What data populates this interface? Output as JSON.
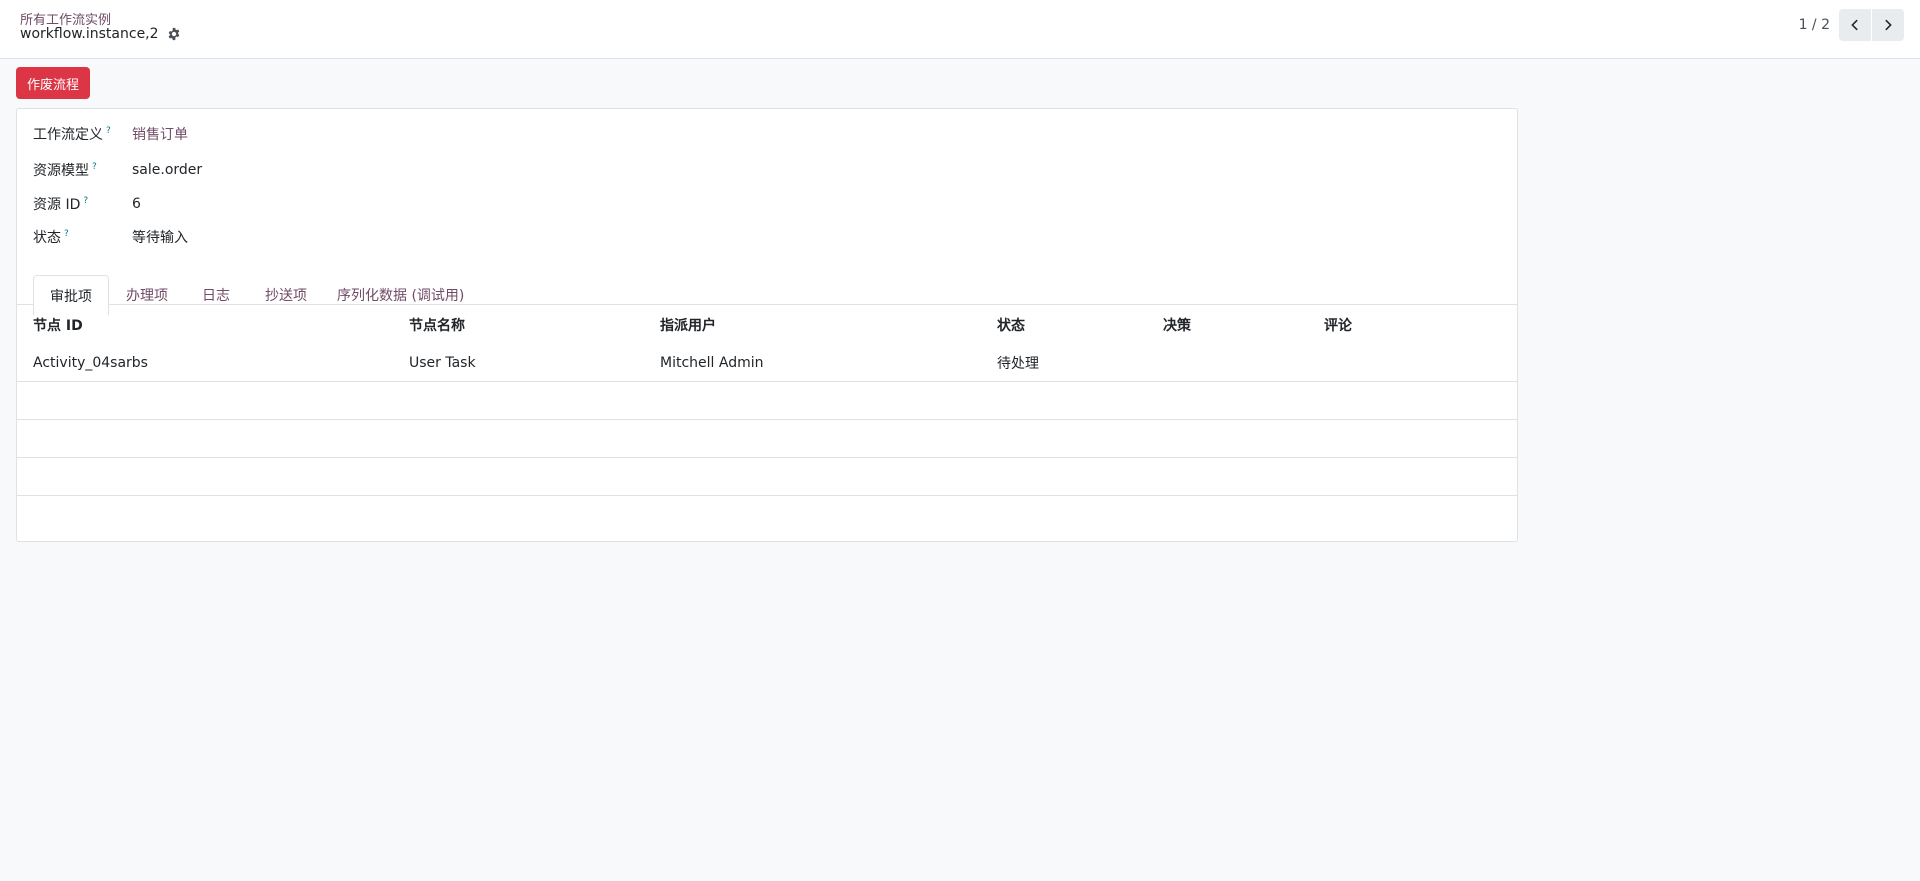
{
  "header": {
    "breadcrumb_parent": "所有工作流实例",
    "record_name": "workflow.instance,2",
    "pager": {
      "value": "1 / 2"
    }
  },
  "actions": {
    "cancel_workflow_label": "作废流程"
  },
  "fields": [
    {
      "label": "工作流定义",
      "help": "?",
      "value": "销售订单",
      "is_link": true
    },
    {
      "label": "资源模型",
      "help": "?",
      "value": "sale.order",
      "is_link": false
    },
    {
      "label": "资源 ID",
      "help": "?",
      "value": "6",
      "is_link": false
    },
    {
      "label": "状态",
      "help": "?",
      "value": "等待输入",
      "is_link": false
    }
  ],
  "tabs": [
    {
      "label": "审批项",
      "active": true
    },
    {
      "label": "办理项",
      "active": false
    },
    {
      "label": "日志",
      "active": false
    },
    {
      "label": "抄送项",
      "active": false
    },
    {
      "label": "序列化数据 (调试用)",
      "active": false
    }
  ],
  "table": {
    "columns": [
      "节点 ID",
      "节点名称",
      "指派用户",
      "状态",
      "决策",
      "评论"
    ],
    "rows": [
      [
        "Activity_04sarbs",
        "User Task",
        "Mitchell Admin",
        "待处理",
        "",
        ""
      ]
    ]
  },
  "colors": {
    "brand": "#714b67",
    "danger": "#dc3545",
    "help": "#017e84"
  }
}
